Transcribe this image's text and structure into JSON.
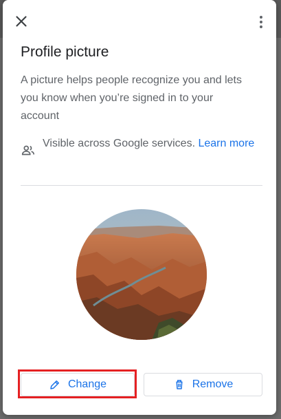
{
  "dialog": {
    "title": "Profile picture",
    "description": "A picture helps people recognize you and lets you know when you’re signed in to your account",
    "visibility_text": "Visible across Google services.",
    "learn_more": "Learn more",
    "photo_alt": "Grand Canyon landscape",
    "change_label": "Change",
    "remove_label": "Remove"
  },
  "icons": {
    "close": "close-icon",
    "menu": "more-vert-icon",
    "visibility": "people-icon",
    "change": "pencil-icon",
    "remove": "trash-icon"
  },
  "colors": {
    "accent": "#1a73e8",
    "highlight": "#e52022"
  }
}
